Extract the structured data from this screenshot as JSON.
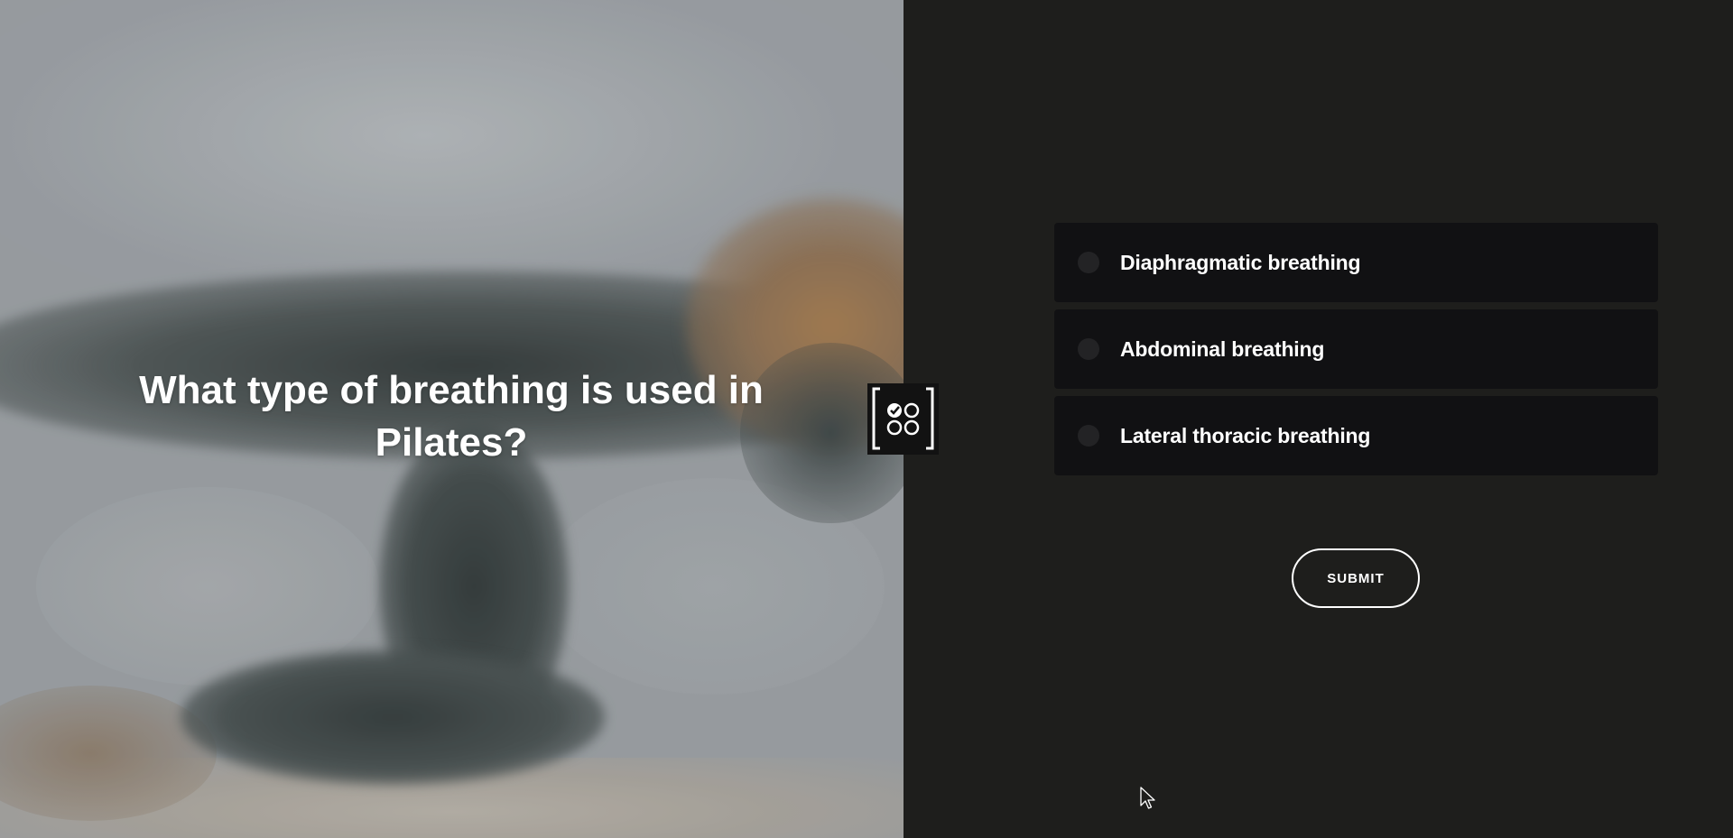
{
  "question": {
    "text": "What type of breathing is used in Pilates?"
  },
  "badge": {
    "icon": "quiz-multiple-choice-icon"
  },
  "options": [
    {
      "label": "Diaphragmatic breathing",
      "selected": false
    },
    {
      "label": "Abdominal breathing",
      "selected": false
    },
    {
      "label": "Lateral thoracic breathing",
      "selected": false
    }
  ],
  "submit": {
    "label": "SUBMIT"
  },
  "colors": {
    "right_panel_bg": "#1e1e1c",
    "option_bg": "#111113",
    "radio_bg": "#232325",
    "text": "#ffffff"
  }
}
